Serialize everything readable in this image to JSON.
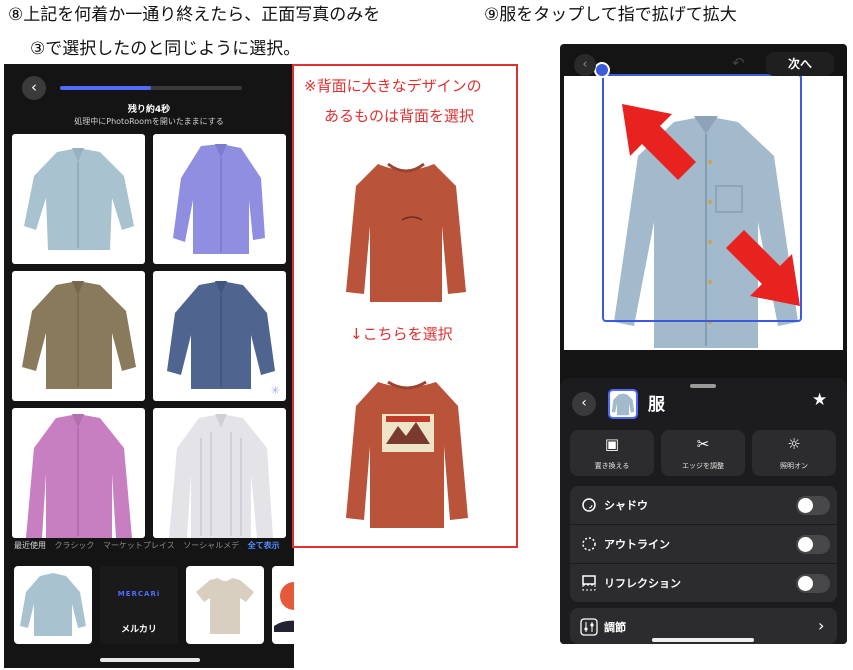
{
  "captions": {
    "step8_line1": "⑧上記を何着か一通り終えたら、正面写真のみを",
    "step8_line2": "③で選択したのと同じように選択。",
    "step9": "⑨服をタップして指で拡げて拡大"
  },
  "left_screen": {
    "progress": 0.5,
    "remaining": "残り約4秒",
    "notice": "処理中にPhotoRoomを開いたままにする",
    "tabs": [
      "最近使用",
      "クラシック",
      "マーケットプレイス",
      "ソーシャルメデ",
      "全て表示"
    ],
    "templates": [
      {
        "label": "MERCARi"
      },
      {
        "label": "メルカリ"
      }
    ]
  },
  "note": {
    "line1": "※背面に大きなデザインの",
    "line2": "あるものは背面を選択",
    "arrow_text": "↓こちらを選択"
  },
  "right_screen": {
    "next_button": "次へ",
    "panel_title": "服",
    "actions": [
      "置き換える",
      "エッジを調整",
      "照明オン"
    ],
    "toggles": [
      {
        "label": "シャドウ",
        "on": false
      },
      {
        "label": "アウトライン",
        "on": false
      },
      {
        "label": "リフレクション",
        "on": false
      }
    ],
    "adjust_label": "調節"
  },
  "colors": {
    "accent_blue": "#4f6bff",
    "note_red": "#e03030",
    "panel_bg": "#1c1c1e"
  }
}
